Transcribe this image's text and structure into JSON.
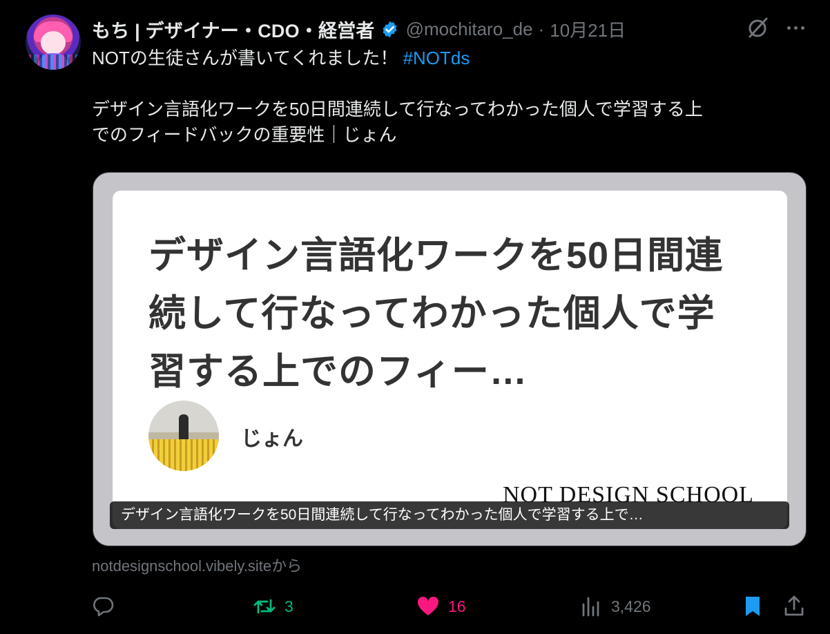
{
  "author": {
    "display_name": "もち | デザイナー・CDO・経営者",
    "handle": "@mochitaro_de",
    "separator": "·",
    "date": "10月21日"
  },
  "tweet": {
    "line1_text": "NOTの生徒さんが書いてくれました！",
    "hashtag": "#NOTds",
    "line2": "デザイン言語化ワークを50日間連続して行なってわかった個人で学習する上",
    "line3": "でのフィードバックの重要性｜じょん"
  },
  "card": {
    "title_lines": [
      "デザイン言語化ワークを50日間連",
      "続して行なってわかった個人で学",
      "習する上でのフィー…"
    ],
    "author_name": "じょん",
    "logo_text": "NOT DESIGN SCHOOL",
    "caption": "デザイン言語化ワークを50日間連続して行なってわかった個人で学習する上で…"
  },
  "source": "notdesignschool.vibely.siteから",
  "actions": {
    "replies": "",
    "retweets": "3",
    "likes": "16",
    "views": "3,426"
  },
  "icons": {
    "verified": "verified-badge-icon",
    "grok": "grok-icon",
    "more": "more-icon",
    "reply": "reply-icon",
    "retweet": "retweet-icon",
    "like": "heart-icon",
    "views": "views-icon",
    "bookmark": "bookmark-icon",
    "share": "share-icon"
  },
  "colors": {
    "background": "#000000",
    "text": "#e7e9ea",
    "muted": "#71767b",
    "link": "#1d9bf0",
    "retweet": "#00ba7c",
    "like": "#f91880"
  }
}
